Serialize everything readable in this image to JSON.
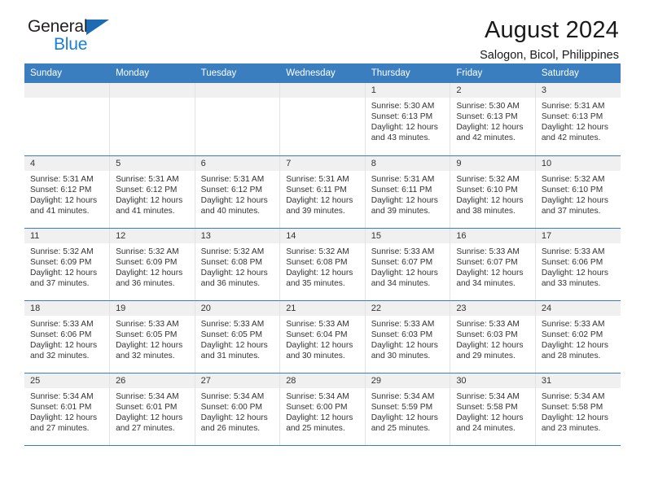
{
  "brand": {
    "name_part1": "General",
    "name_part2": "Blue",
    "accent_color": "#1b7fd4",
    "header_color": "#3a7ebf"
  },
  "header": {
    "title": "August 2024",
    "subtitle": "Salogon, Bicol, Philippines"
  },
  "calendar": {
    "weekday_headers": [
      "Sunday",
      "Monday",
      "Tuesday",
      "Wednesday",
      "Thursday",
      "Friday",
      "Saturday"
    ],
    "labels": {
      "sunrise": "Sunrise:",
      "sunset": "Sunset:",
      "daylight": "Daylight:"
    },
    "weeks": [
      [
        {
          "day": "",
          "empty": true
        },
        {
          "day": "",
          "empty": true
        },
        {
          "day": "",
          "empty": true
        },
        {
          "day": "",
          "empty": true
        },
        {
          "day": "1",
          "sunrise": "Sunrise: 5:30 AM",
          "sunset": "Sunset: 6:13 PM",
          "daylight_line1": "Daylight: 12 hours",
          "daylight_line2": "and 43 minutes."
        },
        {
          "day": "2",
          "sunrise": "Sunrise: 5:30 AM",
          "sunset": "Sunset: 6:13 PM",
          "daylight_line1": "Daylight: 12 hours",
          "daylight_line2": "and 42 minutes."
        },
        {
          "day": "3",
          "sunrise": "Sunrise: 5:31 AM",
          "sunset": "Sunset: 6:13 PM",
          "daylight_line1": "Daylight: 12 hours",
          "daylight_line2": "and 42 minutes."
        }
      ],
      [
        {
          "day": "4",
          "sunrise": "Sunrise: 5:31 AM",
          "sunset": "Sunset: 6:12 PM",
          "daylight_line1": "Daylight: 12 hours",
          "daylight_line2": "and 41 minutes."
        },
        {
          "day": "5",
          "sunrise": "Sunrise: 5:31 AM",
          "sunset": "Sunset: 6:12 PM",
          "daylight_line1": "Daylight: 12 hours",
          "daylight_line2": "and 41 minutes."
        },
        {
          "day": "6",
          "sunrise": "Sunrise: 5:31 AM",
          "sunset": "Sunset: 6:12 PM",
          "daylight_line1": "Daylight: 12 hours",
          "daylight_line2": "and 40 minutes."
        },
        {
          "day": "7",
          "sunrise": "Sunrise: 5:31 AM",
          "sunset": "Sunset: 6:11 PM",
          "daylight_line1": "Daylight: 12 hours",
          "daylight_line2": "and 39 minutes."
        },
        {
          "day": "8",
          "sunrise": "Sunrise: 5:31 AM",
          "sunset": "Sunset: 6:11 PM",
          "daylight_line1": "Daylight: 12 hours",
          "daylight_line2": "and 39 minutes."
        },
        {
          "day": "9",
          "sunrise": "Sunrise: 5:32 AM",
          "sunset": "Sunset: 6:10 PM",
          "daylight_line1": "Daylight: 12 hours",
          "daylight_line2": "and 38 minutes."
        },
        {
          "day": "10",
          "sunrise": "Sunrise: 5:32 AM",
          "sunset": "Sunset: 6:10 PM",
          "daylight_line1": "Daylight: 12 hours",
          "daylight_line2": "and 37 minutes."
        }
      ],
      [
        {
          "day": "11",
          "sunrise": "Sunrise: 5:32 AM",
          "sunset": "Sunset: 6:09 PM",
          "daylight_line1": "Daylight: 12 hours",
          "daylight_line2": "and 37 minutes."
        },
        {
          "day": "12",
          "sunrise": "Sunrise: 5:32 AM",
          "sunset": "Sunset: 6:09 PM",
          "daylight_line1": "Daylight: 12 hours",
          "daylight_line2": "and 36 minutes."
        },
        {
          "day": "13",
          "sunrise": "Sunrise: 5:32 AM",
          "sunset": "Sunset: 6:08 PM",
          "daylight_line1": "Daylight: 12 hours",
          "daylight_line2": "and 36 minutes."
        },
        {
          "day": "14",
          "sunrise": "Sunrise: 5:32 AM",
          "sunset": "Sunset: 6:08 PM",
          "daylight_line1": "Daylight: 12 hours",
          "daylight_line2": "and 35 minutes."
        },
        {
          "day": "15",
          "sunrise": "Sunrise: 5:33 AM",
          "sunset": "Sunset: 6:07 PM",
          "daylight_line1": "Daylight: 12 hours",
          "daylight_line2": "and 34 minutes."
        },
        {
          "day": "16",
          "sunrise": "Sunrise: 5:33 AM",
          "sunset": "Sunset: 6:07 PM",
          "daylight_line1": "Daylight: 12 hours",
          "daylight_line2": "and 34 minutes."
        },
        {
          "day": "17",
          "sunrise": "Sunrise: 5:33 AM",
          "sunset": "Sunset: 6:06 PM",
          "daylight_line1": "Daylight: 12 hours",
          "daylight_line2": "and 33 minutes."
        }
      ],
      [
        {
          "day": "18",
          "sunrise": "Sunrise: 5:33 AM",
          "sunset": "Sunset: 6:06 PM",
          "daylight_line1": "Daylight: 12 hours",
          "daylight_line2": "and 32 minutes."
        },
        {
          "day": "19",
          "sunrise": "Sunrise: 5:33 AM",
          "sunset": "Sunset: 6:05 PM",
          "daylight_line1": "Daylight: 12 hours",
          "daylight_line2": "and 32 minutes."
        },
        {
          "day": "20",
          "sunrise": "Sunrise: 5:33 AM",
          "sunset": "Sunset: 6:05 PM",
          "daylight_line1": "Daylight: 12 hours",
          "daylight_line2": "and 31 minutes."
        },
        {
          "day": "21",
          "sunrise": "Sunrise: 5:33 AM",
          "sunset": "Sunset: 6:04 PM",
          "daylight_line1": "Daylight: 12 hours",
          "daylight_line2": "and 30 minutes."
        },
        {
          "day": "22",
          "sunrise": "Sunrise: 5:33 AM",
          "sunset": "Sunset: 6:03 PM",
          "daylight_line1": "Daylight: 12 hours",
          "daylight_line2": "and 30 minutes."
        },
        {
          "day": "23",
          "sunrise": "Sunrise: 5:33 AM",
          "sunset": "Sunset: 6:03 PM",
          "daylight_line1": "Daylight: 12 hours",
          "daylight_line2": "and 29 minutes."
        },
        {
          "day": "24",
          "sunrise": "Sunrise: 5:33 AM",
          "sunset": "Sunset: 6:02 PM",
          "daylight_line1": "Daylight: 12 hours",
          "daylight_line2": "and 28 minutes."
        }
      ],
      [
        {
          "day": "25",
          "sunrise": "Sunrise: 5:34 AM",
          "sunset": "Sunset: 6:01 PM",
          "daylight_line1": "Daylight: 12 hours",
          "daylight_line2": "and 27 minutes."
        },
        {
          "day": "26",
          "sunrise": "Sunrise: 5:34 AM",
          "sunset": "Sunset: 6:01 PM",
          "daylight_line1": "Daylight: 12 hours",
          "daylight_line2": "and 27 minutes."
        },
        {
          "day": "27",
          "sunrise": "Sunrise: 5:34 AM",
          "sunset": "Sunset: 6:00 PM",
          "daylight_line1": "Daylight: 12 hours",
          "daylight_line2": "and 26 minutes."
        },
        {
          "day": "28",
          "sunrise": "Sunrise: 5:34 AM",
          "sunset": "Sunset: 6:00 PM",
          "daylight_line1": "Daylight: 12 hours",
          "daylight_line2": "and 25 minutes."
        },
        {
          "day": "29",
          "sunrise": "Sunrise: 5:34 AM",
          "sunset": "Sunset: 5:59 PM",
          "daylight_line1": "Daylight: 12 hours",
          "daylight_line2": "and 25 minutes."
        },
        {
          "day": "30",
          "sunrise": "Sunrise: 5:34 AM",
          "sunset": "Sunset: 5:58 PM",
          "daylight_line1": "Daylight: 12 hours",
          "daylight_line2": "and 24 minutes."
        },
        {
          "day": "31",
          "sunrise": "Sunrise: 5:34 AM",
          "sunset": "Sunset: 5:58 PM",
          "daylight_line1": "Daylight: 12 hours",
          "daylight_line2": "and 23 minutes."
        }
      ]
    ]
  }
}
